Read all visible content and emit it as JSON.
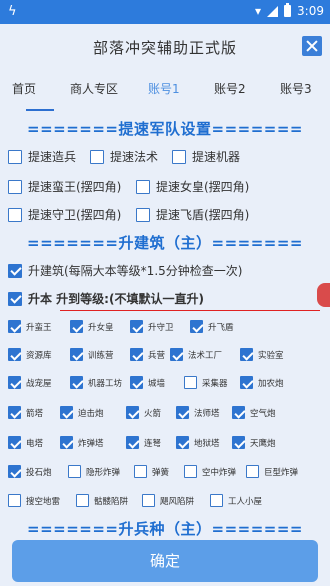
{
  "status": {
    "time": "3:09"
  },
  "header": {
    "title": "部落冲突辅助正式版"
  },
  "tabs": [
    "首页",
    "商人专区",
    "账号1",
    "账号2",
    "账号3"
  ],
  "sections": {
    "army_speed": "=======提速军队设置=======",
    "build": "=======升建筑（主）=======",
    "troops": "=======升兵种（主）======="
  },
  "army_options": [
    "提速造兵",
    "提速法术",
    "提速机器",
    "提速蛮王(摆四角)",
    "提速女皇(摆四角)",
    "提速守卫(摆四角)",
    "提速飞盾(摆四角)"
  ],
  "build_options": {
    "upgrade_building": "升建筑(每隔大本等级*1.5分钟检查一次)",
    "upgrade_to_level": "升本 升到等级:(不填默认一直升)"
  },
  "buildings": [
    "升蛮王",
    "升女皇",
    "升守卫",
    "升飞盾",
    "资源库",
    "训练营",
    "兵营",
    "法术工厂",
    "实验室",
    "战宠屋",
    "机器工坊",
    "城墙",
    "采集器",
    "加农炮",
    "箭塔",
    "迫击炮",
    "火箭",
    "法师塔",
    "空气炮",
    "电塔",
    "炸弹塔",
    "连弩",
    "地狱塔",
    "天鹰炮",
    "投石炮",
    "隐形炸弹",
    "弹簧",
    "空中炸弹",
    "巨型炸弹",
    "搜空地雷",
    "骷髅陷阱",
    "飓风陷阱",
    "工人小屋"
  ],
  "confirm_label": "确定"
}
